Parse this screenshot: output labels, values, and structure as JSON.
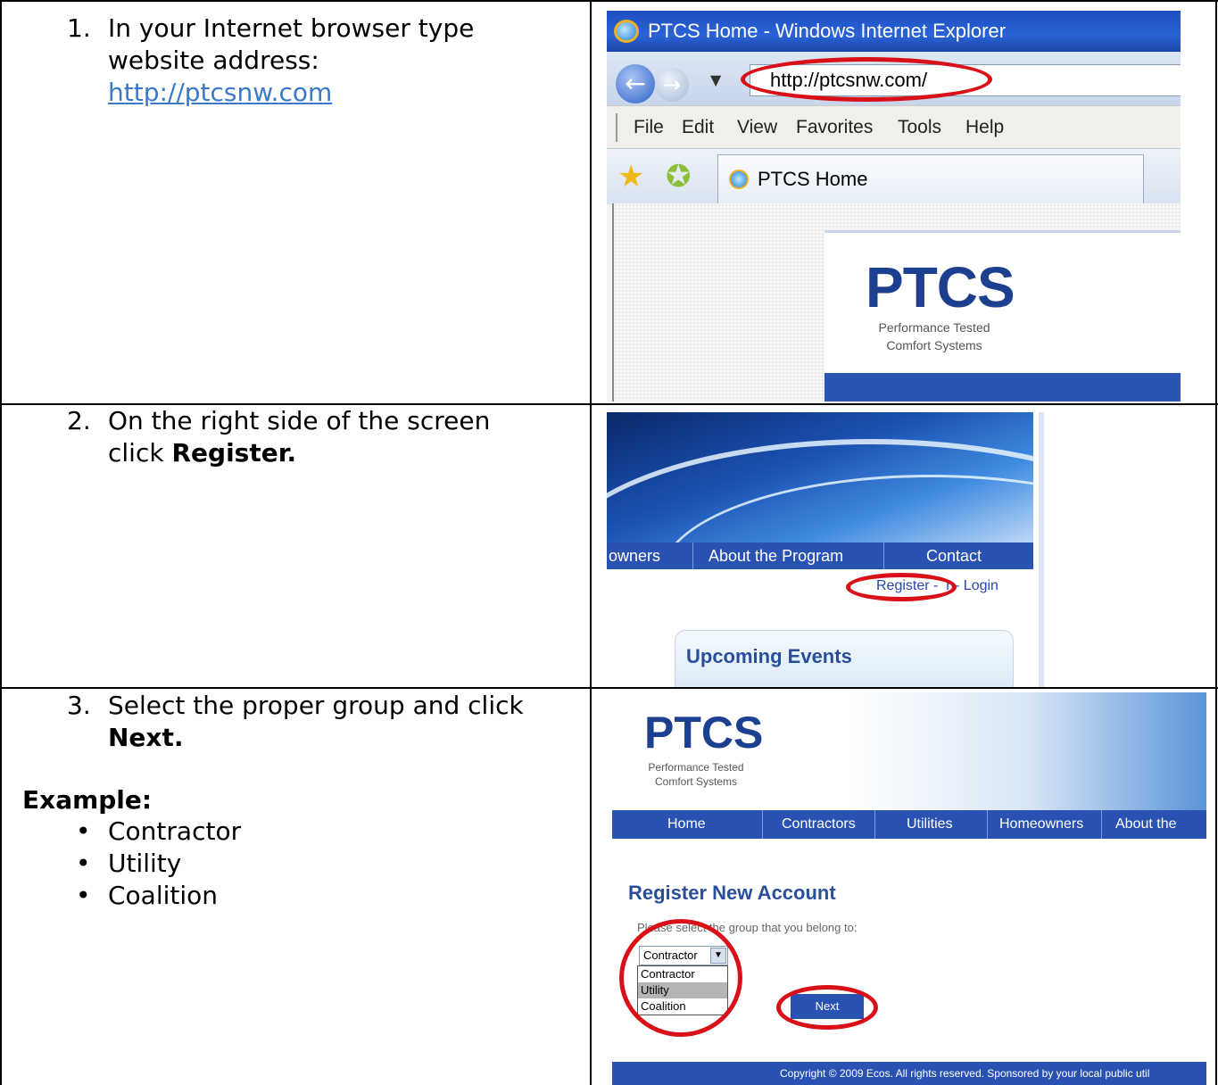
{
  "steps": [
    {
      "number": "1.",
      "line1": "In your Internet browser type",
      "line2": "website address:",
      "link": "http://ptcsnw.com"
    },
    {
      "number": "2.",
      "line1": "On the right side of the screen",
      "line2_prefix": "click ",
      "line2_bold": "Register."
    },
    {
      "number": "3.",
      "line1": "Select the proper group and click",
      "line2_bold": "Next.",
      "example_label": "Example:",
      "examples": [
        "Contractor",
        "Utility",
        "Coalition"
      ]
    }
  ],
  "shot1": {
    "window_title": "PTCS Home - Windows Internet Explorer",
    "address": "http://ptcsnw.com/",
    "menu": [
      "File",
      "Edit",
      "View",
      "Favorites",
      "Tools",
      "Help"
    ],
    "tab_title": "PTCS Home",
    "logo": "PTCS",
    "logo_sub": "Performance Tested Comfort Systems",
    "highlight_color": "#d91018"
  },
  "shot2": {
    "nav": [
      "owners",
      "About the Program",
      "Contact"
    ],
    "register_login": "Register - Register - Login",
    "register_visible": "Register -",
    "login_visible": "r - Login",
    "events_title": "Upcoming Events"
  },
  "shot3": {
    "logo": "PTCS",
    "logo_sub": "Performance Tested Comfort Systems",
    "nav": [
      "Home",
      "Contractors",
      "Utilities",
      "Homeowners",
      "About the Prog"
    ],
    "page_title": "Register New Account",
    "hint": "Please select the group that you belong to:",
    "select_value": "Contractor",
    "options": [
      "Contractor",
      "Utility",
      "Coalition"
    ],
    "selected_option": "Utility",
    "next_label": "Next",
    "footer": "Copyright © 2009 Ecos. All rights reserved. Sponsored by your local public util"
  }
}
